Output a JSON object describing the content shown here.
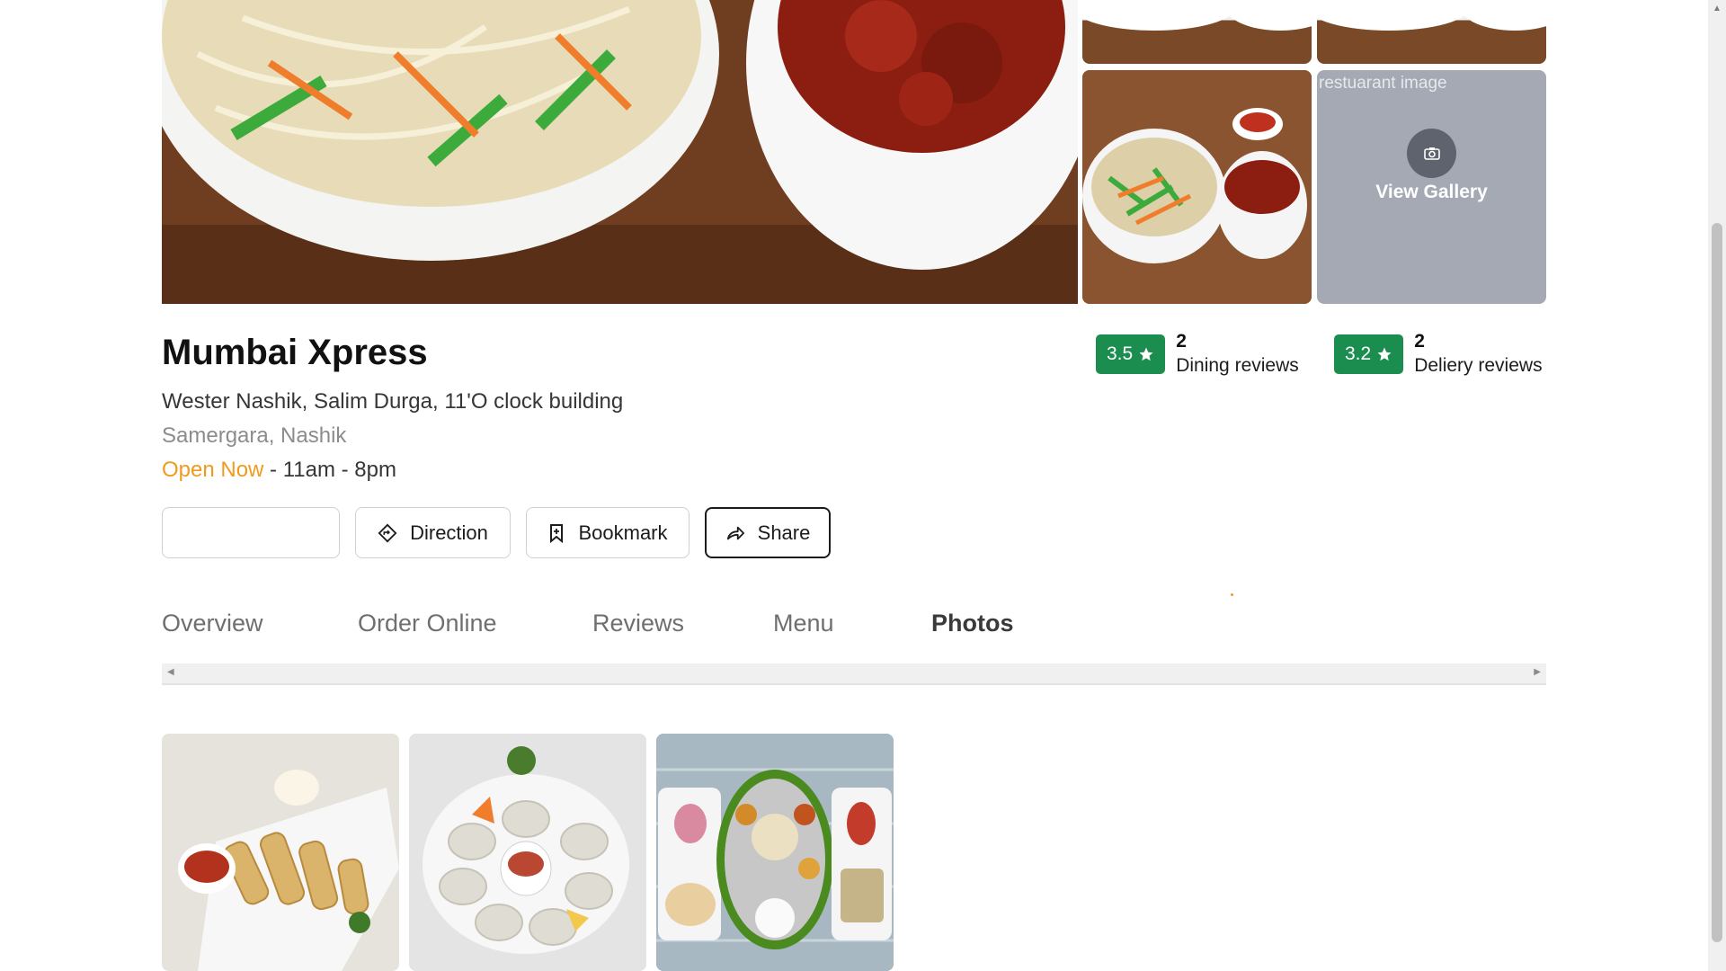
{
  "restaurant": {
    "name": "Mumbai Xpress",
    "address": "Wester Nashik, Salim Durga, 11'O clock building",
    "locality": "Samergara, Nashik",
    "open_status": "Open Now",
    "hours": " - 11am - 8pm"
  },
  "gallery": {
    "broken_image_alt": "restuarant image",
    "view_gallery_label": "View Gallery",
    "camera_icon": "camera-icon"
  },
  "ratings": [
    {
      "score": "3.5",
      "count": "2",
      "label": "Dining reviews"
    },
    {
      "score": "3.2",
      "count": "2",
      "label": "Deliery reviews"
    }
  ],
  "actions": {
    "direction_label": "Direction",
    "bookmark_label": "Bookmark",
    "share_label": "Share"
  },
  "tabs": [
    {
      "label": "Overview"
    },
    {
      "label": "Order Online"
    },
    {
      "label": "Reviews"
    },
    {
      "label": "Menu"
    },
    {
      "label": "Photos",
      "active": true
    }
  ],
  "colors": {
    "rating_green": "#1b8e4f",
    "open_orange": "#f09a1e",
    "gallery_overlay": "#a4a9b4"
  }
}
